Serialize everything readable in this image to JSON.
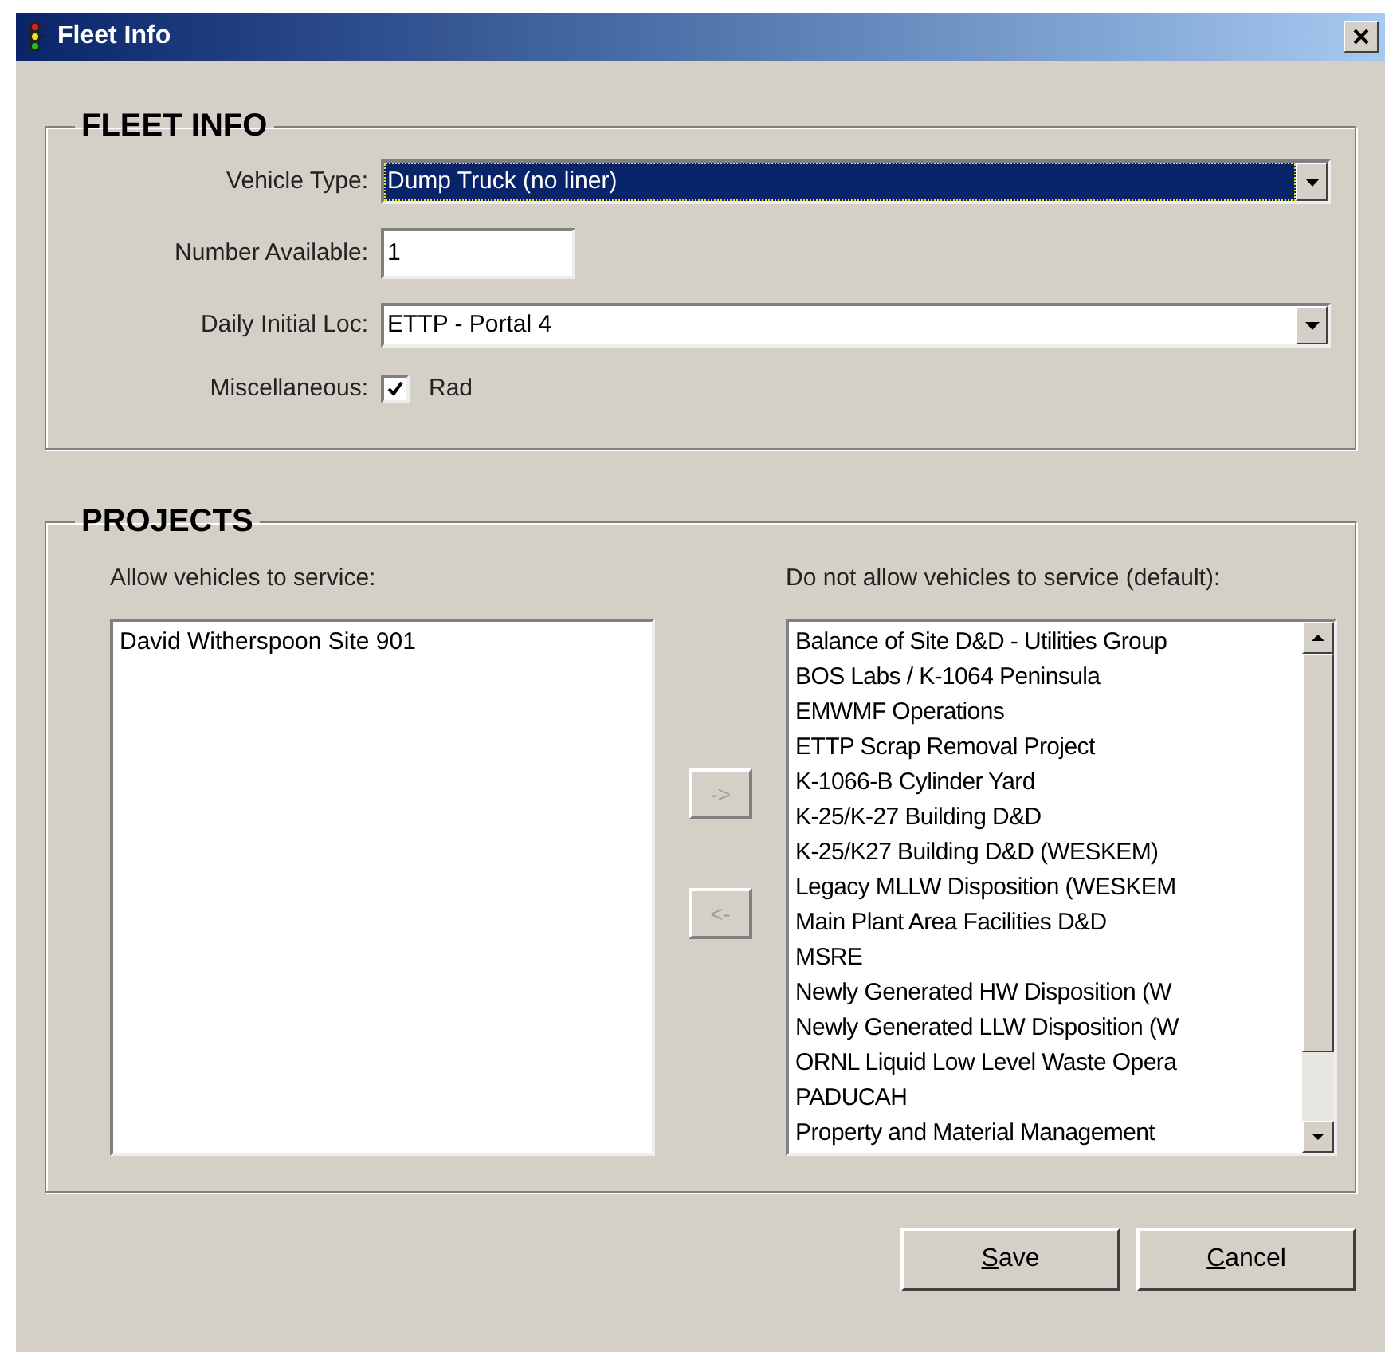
{
  "window": {
    "title": "Fleet Info"
  },
  "fleet_info": {
    "heading": "FLEET INFO",
    "fields": [
      {
        "kind": "combo",
        "label": "Vehicle Type:",
        "value": "Dump Truck (no liner)",
        "selected": true
      },
      {
        "kind": "text",
        "label": "Number Available:",
        "value": "1"
      },
      {
        "kind": "combo",
        "label": "Daily Initial Loc:",
        "value": "ETTP - Portal 4",
        "selected": false
      },
      {
        "kind": "checkbox",
        "label": "Miscellaneous:",
        "option": "Rad",
        "checked": true
      }
    ]
  },
  "projects": {
    "heading": "PROJECTS",
    "allowed": {
      "label": "Allow vehicles to service:",
      "items": [
        "David Witherspoon Site 901"
      ]
    },
    "move_buttons": [
      {
        "label": "->",
        "disabled": true
      },
      {
        "label": "<-",
        "disabled": true
      }
    ],
    "denied": {
      "label": "Do not allow vehicles to service (default):",
      "items": [
        "Balance of Site D&D - Utilities Group",
        "BOS Labs / K-1064 Peninsula",
        "EMWMF Operations",
        "ETTP Scrap Removal Project",
        "K-1066-B Cylinder Yard",
        "K-25/K-27 Building D&D",
        "K-25/K27 Building D&D (WESKEM)",
        "Legacy MLLW Disposition (WESKEM",
        "Main Plant Area Facilities D&D",
        "MSRE",
        "Newly Generated HW Disposition (W",
        "Newly Generated LLW Disposition (W",
        "ORNL Liquid Low Level Waste Opera",
        "PADUCAH",
        "Property and Material Management"
      ]
    }
  },
  "buttons": [
    {
      "label": "Save",
      "underline_first": true
    },
    {
      "label": "Cancel",
      "underline_first": true
    }
  ]
}
